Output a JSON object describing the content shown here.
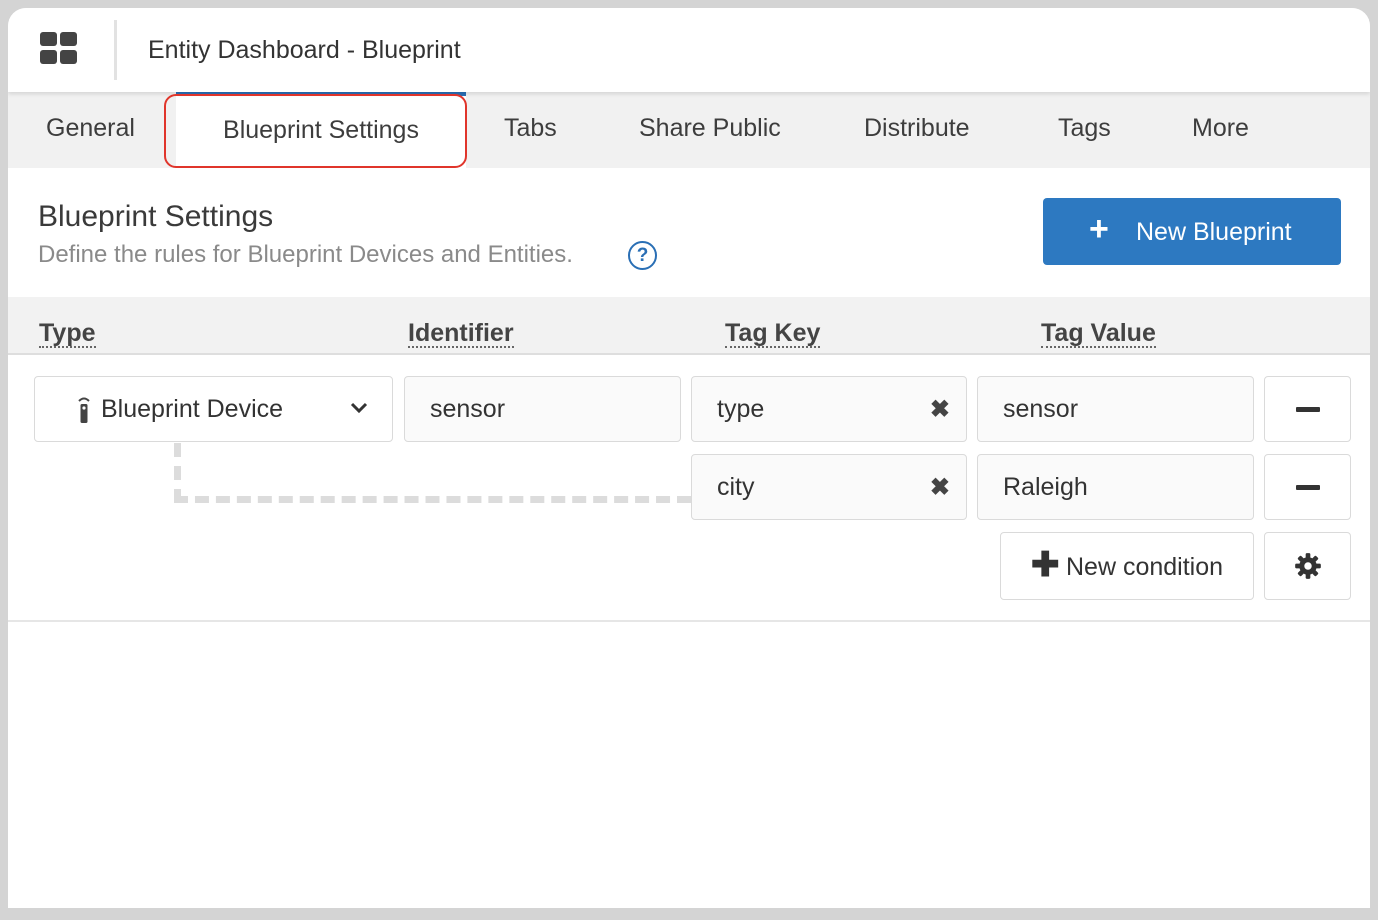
{
  "header": {
    "title": "Entity Dashboard - Blueprint",
    "icon": "dashboard-grid-icon"
  },
  "tabs": [
    {
      "label": "General"
    },
    {
      "label": "Blueprint Settings",
      "active": true
    },
    {
      "label": "Tabs"
    },
    {
      "label": "Share Public"
    },
    {
      "label": "Distribute"
    },
    {
      "label": "Tags"
    },
    {
      "label": "More"
    }
  ],
  "section": {
    "title": "Blueprint Settings",
    "subtitle": "Define the rules for Blueprint Devices and Entities.",
    "help_glyph": "?",
    "new_blueprint_plus": "+",
    "new_blueprint_label": "New Blueprint"
  },
  "table": {
    "headers": [
      "Type",
      "Identifier",
      "Tag Key",
      "Tag Value"
    ]
  },
  "rule": {
    "type_value": "Blueprint Device",
    "identifier_value": "sensor",
    "conditions": [
      {
        "tag_key": "type",
        "tag_value": "sensor"
      },
      {
        "tag_key": "city",
        "tag_value": "Raleigh"
      }
    ],
    "clear_glyph": "✖",
    "new_condition_plus": "✚",
    "new_condition_label": "New condition"
  },
  "colors": {
    "accent": "#2d79c1",
    "highlight": "#e0352b"
  }
}
